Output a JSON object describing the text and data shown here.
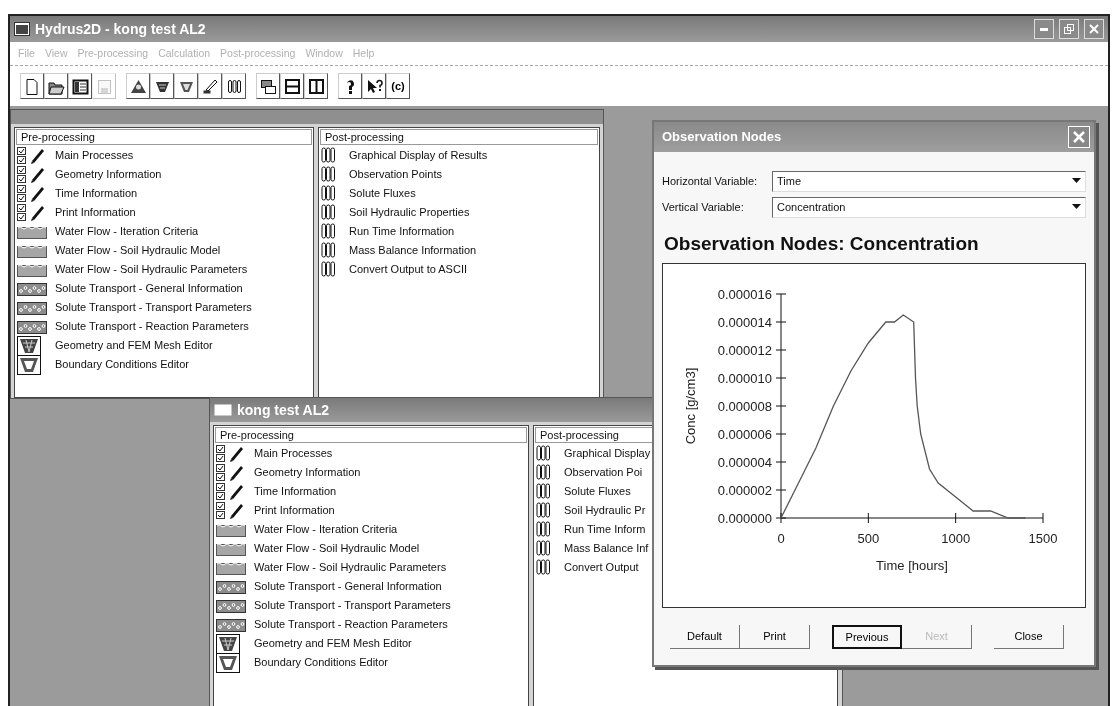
{
  "window": {
    "title": "Hydrus2D - kong test AL2"
  },
  "menu": [
    {
      "label": "File",
      "disabled": true
    },
    {
      "label": "View",
      "disabled": true
    },
    {
      "label": "Pre-processing",
      "disabled": true
    },
    {
      "label": "Calculation",
      "disabled": true
    },
    {
      "label": "Post-processing",
      "disabled": true
    },
    {
      "label": "Window",
      "disabled": true
    },
    {
      "label": "Help",
      "disabled": true
    }
  ],
  "toolbar_groups": [
    {
      "buttons": [
        {
          "kind": "new-file",
          "disabled": false
        },
        {
          "kind": "open-folder",
          "disabled": false
        },
        {
          "kind": "table",
          "disabled": false
        },
        {
          "kind": "save",
          "disabled": true
        }
      ]
    },
    {
      "buttons": [
        {
          "kind": "pyramid",
          "disabled": false
        },
        {
          "kind": "mesh",
          "disabled": false
        },
        {
          "kind": "boundary",
          "disabled": false
        },
        {
          "kind": "pen-hand",
          "disabled": false
        },
        {
          "kind": "tubes",
          "disabled": false
        }
      ]
    },
    {
      "buttons": [
        {
          "kind": "cascade",
          "disabled": false
        },
        {
          "kind": "tile-horizontal",
          "disabled": false
        },
        {
          "kind": "tile-vertical",
          "disabled": false
        }
      ]
    },
    {
      "buttons": [
        {
          "kind": "help",
          "disabled": false
        },
        {
          "kind": "context-help",
          "disabled": false
        },
        {
          "kind": "text",
          "label": "(c)",
          "disabled": false
        }
      ]
    }
  ],
  "main_window": {
    "pre_processing": {
      "header": "Pre-processing",
      "items": [
        {
          "kind": "processes",
          "checked": true,
          "label": "Main Processes"
        },
        {
          "kind": "processes",
          "checked": true,
          "label": "Geometry Information"
        },
        {
          "kind": "processes",
          "checked": true,
          "label": "Time Information"
        },
        {
          "kind": "processes",
          "checked": true,
          "label": "Print Information"
        },
        {
          "kind": "water",
          "label": "Water Flow - Iteration Criteria"
        },
        {
          "kind": "water",
          "label": "Water Flow - Soil Hydraulic Model"
        },
        {
          "kind": "water",
          "label": "Water Flow - Soil Hydraulic Parameters"
        },
        {
          "kind": "solute",
          "label": "Solute Transport - General Information"
        },
        {
          "kind": "solute",
          "label": "Solute Transport - Transport Parameters"
        },
        {
          "kind": "solute",
          "label": "Solute Transport - Reaction Parameters"
        },
        {
          "kind": "mesh",
          "label": "Geometry and FEM Mesh Editor"
        },
        {
          "kind": "boundary",
          "label": "Boundary Conditions Editor"
        }
      ]
    },
    "post_processing": {
      "header": "Post-processing",
      "items": [
        {
          "label": "Graphical Display of Results"
        },
        {
          "label": "Observation Points"
        },
        {
          "label": "Solute Fluxes"
        },
        {
          "label": "Soil Hydraulic Properties"
        },
        {
          "label": "Run Time Information"
        },
        {
          "label": "Mass Balance Information"
        },
        {
          "label": "Convert Output to ASCII"
        }
      ]
    }
  },
  "child_window": {
    "title": "kong test AL2",
    "pre_processing": {
      "header": "Pre-processing",
      "items": [
        {
          "kind": "processes",
          "checked": true,
          "label": "Main Processes"
        },
        {
          "kind": "processes",
          "checked": true,
          "label": "Geometry Information"
        },
        {
          "kind": "processes",
          "checked": true,
          "label": "Time Information"
        },
        {
          "kind": "processes",
          "checked": true,
          "label": "Print Information"
        },
        {
          "kind": "water",
          "label": "Water Flow - Iteration Criteria"
        },
        {
          "kind": "water",
          "label": "Water Flow - Soil Hydraulic Model"
        },
        {
          "kind": "water",
          "label": "Water Flow - Soil Hydraulic Parameters"
        },
        {
          "kind": "solute",
          "label": "Solute Transport - General Information"
        },
        {
          "kind": "solute",
          "label": "Solute Transport - Transport Parameters"
        },
        {
          "kind": "solute",
          "label": "Solute Transport - Reaction Parameters"
        },
        {
          "kind": "mesh",
          "label": "Geometry and FEM Mesh Editor"
        },
        {
          "kind": "boundary",
          "label": "Boundary Conditions Editor"
        }
      ]
    },
    "post_processing": {
      "header": "Post-processing",
      "items": [
        {
          "label": "Graphical Display"
        },
        {
          "label": "Observation Poi"
        },
        {
          "label": "Solute Fluxes"
        },
        {
          "label": "Soil Hydraulic Pr"
        },
        {
          "label": "Run Time Inform"
        },
        {
          "label": "Mass Balance Inf"
        },
        {
          "label": "Convert Output"
        }
      ]
    }
  },
  "dialog": {
    "title": "Observation Nodes",
    "fields": [
      {
        "label": "Horizontal Variable:",
        "value": "Time"
      },
      {
        "label": "Vertical Variable:",
        "value": "Concentration"
      }
    ],
    "chart_data": {
      "type": "line",
      "title": "Observation Nodes: Concentration",
      "xlabel": "Time [hours]",
      "ylabel": "Conc [g/cm3]",
      "x": [
        0,
        100,
        200,
        300,
        400,
        500,
        600,
        650,
        700,
        760,
        770,
        780,
        800,
        850,
        900,
        1000,
        1100,
        1200,
        1300,
        1400
      ],
      "series": [
        {
          "color": "#555555",
          "values": [
            0,
            2.5e-06,
            5e-06,
            8e-06,
            1.05e-05,
            1.25e-05,
            1.4e-05,
            1.4e-05,
            1.45e-05,
            1.4e-05,
            1e-05,
            8e-06,
            6e-06,
            3.5e-06,
            2.5e-06,
            1.5e-06,
            5e-07,
            5e-07,
            0,
            0
          ]
        }
      ],
      "xlim": [
        0,
        1500
      ],
      "ylim": [
        0,
        1.6e-05
      ],
      "xticks": [
        0,
        500,
        1000,
        1500
      ],
      "yticks": [
        {
          "value": 0,
          "label": "0.000000"
        },
        {
          "value": 2e-06,
          "label": "0.000002"
        },
        {
          "value": 4e-06,
          "label": "0.000004"
        },
        {
          "value": 6e-06,
          "label": "0.000006"
        },
        {
          "value": 8e-06,
          "label": "0.000008"
        },
        {
          "value": 1e-05,
          "label": "0.000010"
        },
        {
          "value": 1.2e-05,
          "label": "0.000012"
        },
        {
          "value": 1.4e-05,
          "label": "0.000014"
        },
        {
          "value": 1.6e-05,
          "label": "0.000016"
        }
      ]
    },
    "buttons": [
      {
        "label": "Default",
        "default": false,
        "disabled": false
      },
      {
        "label": "Print",
        "default": false,
        "disabled": false
      },
      {
        "label": "Previous",
        "default": true,
        "disabled": false
      },
      {
        "label": "Next",
        "default": false,
        "disabled": true
      },
      {
        "label": "Close",
        "default": false,
        "disabled": false
      }
    ]
  }
}
